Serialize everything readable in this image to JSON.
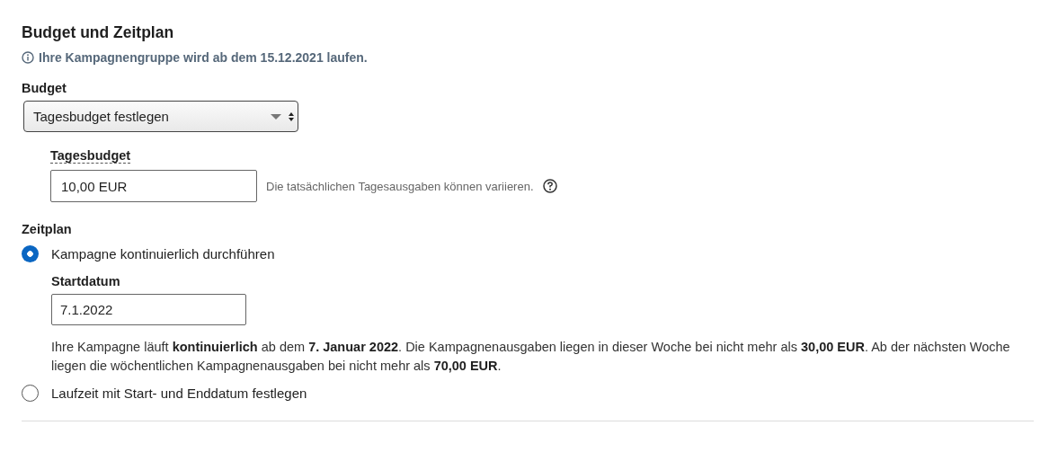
{
  "section": {
    "title": "Budget und Zeitplan",
    "info": "Ihre Kampagnengruppe wird ab dem 15.12.2021 laufen."
  },
  "budget": {
    "label": "Budget",
    "select_value": "Tagesbudget festlegen",
    "amount_label": "Tagesbudget",
    "amount_value": "10,00 EUR",
    "hint": "Die tatsächlichen Tagesausgaben können variieren."
  },
  "schedule": {
    "label": "Zeitplan",
    "options": [
      {
        "label": "Kampagne kontinuierlich durchführen",
        "selected": true
      },
      {
        "label": "Laufzeit mit Start- und Enddatum festlegen",
        "selected": false
      }
    ],
    "start_date_label": "Startdatum",
    "start_date_value": "7.1.2022",
    "summary": "Ihre Kampagne läuft **kontinuierlich** ab dem **7. Januar 2022**. Die Kampagnenausgaben liegen in dieser Woche bei nicht mehr als **30,00 EUR**. Ab der nächsten Woche liegen die wöchentlichen Kampagnenausgaben bei nicht mehr als **70,00 EUR**."
  }
}
